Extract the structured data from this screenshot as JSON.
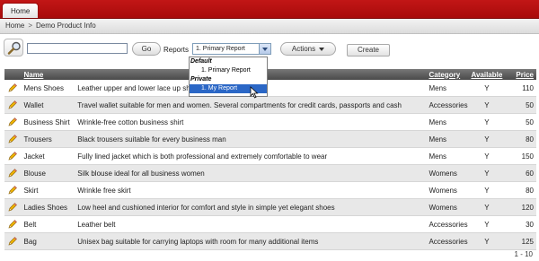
{
  "tabs": {
    "home": "Home"
  },
  "breadcrumb": {
    "home": "Home",
    "separator": ">",
    "current": "Demo Product Info"
  },
  "search": {
    "value": "",
    "go_label": "Go",
    "reports_label": "Reports",
    "selected_report": "1. Primary Report",
    "actions_label": "Actions",
    "create_label": "Create"
  },
  "dropdown": {
    "groups": [
      {
        "label": "Default",
        "options": [
          "1. Primary Report"
        ]
      },
      {
        "label": "Private",
        "options": [
          "1. My Report"
        ]
      }
    ],
    "highlighted": "1. My Report"
  },
  "table": {
    "headers": {
      "name": "Name",
      "category": "Category",
      "available": "Available",
      "price": "Price"
    },
    "rows": [
      {
        "name": "Mens Shoes",
        "description": "Leather upper and lower lace up shoes",
        "category": "Mens",
        "available": "Y",
        "price": "110"
      },
      {
        "name": "Wallet",
        "description": "Travel wallet suitable for men and women. Several compartments for credit cards, passports and cash",
        "category": "Accessories",
        "available": "Y",
        "price": "50"
      },
      {
        "name": "Business Shirt",
        "description": "Wrinkle-free cotton business shirt",
        "category": "Mens",
        "available": "Y",
        "price": "50"
      },
      {
        "name": "Trousers",
        "description": "Black trousers suitable for every business man",
        "category": "Mens",
        "available": "Y",
        "price": "80"
      },
      {
        "name": "Jacket",
        "description": "Fully lined jacket which is both professional and extremely comfortable to wear",
        "category": "Mens",
        "available": "Y",
        "price": "150"
      },
      {
        "name": "Blouse",
        "description": "Silk blouse ideal for all business women",
        "category": "Womens",
        "available": "Y",
        "price": "60"
      },
      {
        "name": "Skirt",
        "description": "Wrinkle free skirt",
        "category": "Womens",
        "available": "Y",
        "price": "80"
      },
      {
        "name": "Ladies Shoes",
        "description": "Low heel and cushioned interior for comfort and style in simple yet elegant shoes",
        "category": "Womens",
        "available": "Y",
        "price": "120"
      },
      {
        "name": "Belt",
        "description": "Leather belt",
        "category": "Accessories",
        "available": "Y",
        "price": "30"
      },
      {
        "name": "Bag",
        "description": "Unisex bag suitable for carrying laptops with room for many additional items",
        "category": "Accessories",
        "available": "Y",
        "price": "125"
      }
    ]
  },
  "pagination": {
    "range": "1 - 10"
  },
  "icons": {
    "search": "magnifier-icon",
    "edit": "pencil-icon",
    "cursor": "mouse-pointer-icon"
  },
  "colors": {
    "topbar": "#b51010",
    "header": "#5a5a5a",
    "selection": "#2b67c6"
  }
}
